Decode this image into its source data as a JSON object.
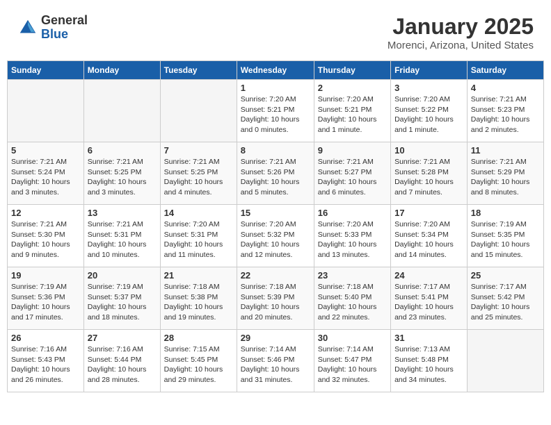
{
  "logo": {
    "general": "General",
    "blue": "Blue"
  },
  "header": {
    "month_title": "January 2025",
    "location": "Morenci, Arizona, United States"
  },
  "weekdays": [
    "Sunday",
    "Monday",
    "Tuesday",
    "Wednesday",
    "Thursday",
    "Friday",
    "Saturday"
  ],
  "weeks": [
    [
      {
        "day": "",
        "sunrise": "",
        "sunset": "",
        "daylight": ""
      },
      {
        "day": "",
        "sunrise": "",
        "sunset": "",
        "daylight": ""
      },
      {
        "day": "",
        "sunrise": "",
        "sunset": "",
        "daylight": ""
      },
      {
        "day": "1",
        "sunrise": "Sunrise: 7:20 AM",
        "sunset": "Sunset: 5:21 PM",
        "daylight": "Daylight: 10 hours and 0 minutes."
      },
      {
        "day": "2",
        "sunrise": "Sunrise: 7:20 AM",
        "sunset": "Sunset: 5:21 PM",
        "daylight": "Daylight: 10 hours and 1 minute."
      },
      {
        "day": "3",
        "sunrise": "Sunrise: 7:20 AM",
        "sunset": "Sunset: 5:22 PM",
        "daylight": "Daylight: 10 hours and 1 minute."
      },
      {
        "day": "4",
        "sunrise": "Sunrise: 7:21 AM",
        "sunset": "Sunset: 5:23 PM",
        "daylight": "Daylight: 10 hours and 2 minutes."
      }
    ],
    [
      {
        "day": "5",
        "sunrise": "Sunrise: 7:21 AM",
        "sunset": "Sunset: 5:24 PM",
        "daylight": "Daylight: 10 hours and 3 minutes."
      },
      {
        "day": "6",
        "sunrise": "Sunrise: 7:21 AM",
        "sunset": "Sunset: 5:25 PM",
        "daylight": "Daylight: 10 hours and 3 minutes."
      },
      {
        "day": "7",
        "sunrise": "Sunrise: 7:21 AM",
        "sunset": "Sunset: 5:25 PM",
        "daylight": "Daylight: 10 hours and 4 minutes."
      },
      {
        "day": "8",
        "sunrise": "Sunrise: 7:21 AM",
        "sunset": "Sunset: 5:26 PM",
        "daylight": "Daylight: 10 hours and 5 minutes."
      },
      {
        "day": "9",
        "sunrise": "Sunrise: 7:21 AM",
        "sunset": "Sunset: 5:27 PM",
        "daylight": "Daylight: 10 hours and 6 minutes."
      },
      {
        "day": "10",
        "sunrise": "Sunrise: 7:21 AM",
        "sunset": "Sunset: 5:28 PM",
        "daylight": "Daylight: 10 hours and 7 minutes."
      },
      {
        "day": "11",
        "sunrise": "Sunrise: 7:21 AM",
        "sunset": "Sunset: 5:29 PM",
        "daylight": "Daylight: 10 hours and 8 minutes."
      }
    ],
    [
      {
        "day": "12",
        "sunrise": "Sunrise: 7:21 AM",
        "sunset": "Sunset: 5:30 PM",
        "daylight": "Daylight: 10 hours and 9 minutes."
      },
      {
        "day": "13",
        "sunrise": "Sunrise: 7:21 AM",
        "sunset": "Sunset: 5:31 PM",
        "daylight": "Daylight: 10 hours and 10 minutes."
      },
      {
        "day": "14",
        "sunrise": "Sunrise: 7:20 AM",
        "sunset": "Sunset: 5:31 PM",
        "daylight": "Daylight: 10 hours and 11 minutes."
      },
      {
        "day": "15",
        "sunrise": "Sunrise: 7:20 AM",
        "sunset": "Sunset: 5:32 PM",
        "daylight": "Daylight: 10 hours and 12 minutes."
      },
      {
        "day": "16",
        "sunrise": "Sunrise: 7:20 AM",
        "sunset": "Sunset: 5:33 PM",
        "daylight": "Daylight: 10 hours and 13 minutes."
      },
      {
        "day": "17",
        "sunrise": "Sunrise: 7:20 AM",
        "sunset": "Sunset: 5:34 PM",
        "daylight": "Daylight: 10 hours and 14 minutes."
      },
      {
        "day": "18",
        "sunrise": "Sunrise: 7:19 AM",
        "sunset": "Sunset: 5:35 PM",
        "daylight": "Daylight: 10 hours and 15 minutes."
      }
    ],
    [
      {
        "day": "19",
        "sunrise": "Sunrise: 7:19 AM",
        "sunset": "Sunset: 5:36 PM",
        "daylight": "Daylight: 10 hours and 17 minutes."
      },
      {
        "day": "20",
        "sunrise": "Sunrise: 7:19 AM",
        "sunset": "Sunset: 5:37 PM",
        "daylight": "Daylight: 10 hours and 18 minutes."
      },
      {
        "day": "21",
        "sunrise": "Sunrise: 7:18 AM",
        "sunset": "Sunset: 5:38 PM",
        "daylight": "Daylight: 10 hours and 19 minutes."
      },
      {
        "day": "22",
        "sunrise": "Sunrise: 7:18 AM",
        "sunset": "Sunset: 5:39 PM",
        "daylight": "Daylight: 10 hours and 20 minutes."
      },
      {
        "day": "23",
        "sunrise": "Sunrise: 7:18 AM",
        "sunset": "Sunset: 5:40 PM",
        "daylight": "Daylight: 10 hours and 22 minutes."
      },
      {
        "day": "24",
        "sunrise": "Sunrise: 7:17 AM",
        "sunset": "Sunset: 5:41 PM",
        "daylight": "Daylight: 10 hours and 23 minutes."
      },
      {
        "day": "25",
        "sunrise": "Sunrise: 7:17 AM",
        "sunset": "Sunset: 5:42 PM",
        "daylight": "Daylight: 10 hours and 25 minutes."
      }
    ],
    [
      {
        "day": "26",
        "sunrise": "Sunrise: 7:16 AM",
        "sunset": "Sunset: 5:43 PM",
        "daylight": "Daylight: 10 hours and 26 minutes."
      },
      {
        "day": "27",
        "sunrise": "Sunrise: 7:16 AM",
        "sunset": "Sunset: 5:44 PM",
        "daylight": "Daylight: 10 hours and 28 minutes."
      },
      {
        "day": "28",
        "sunrise": "Sunrise: 7:15 AM",
        "sunset": "Sunset: 5:45 PM",
        "daylight": "Daylight: 10 hours and 29 minutes."
      },
      {
        "day": "29",
        "sunrise": "Sunrise: 7:14 AM",
        "sunset": "Sunset: 5:46 PM",
        "daylight": "Daylight: 10 hours and 31 minutes."
      },
      {
        "day": "30",
        "sunrise": "Sunrise: 7:14 AM",
        "sunset": "Sunset: 5:47 PM",
        "daylight": "Daylight: 10 hours and 32 minutes."
      },
      {
        "day": "31",
        "sunrise": "Sunrise: 7:13 AM",
        "sunset": "Sunset: 5:48 PM",
        "daylight": "Daylight: 10 hours and 34 minutes."
      },
      {
        "day": "",
        "sunrise": "",
        "sunset": "",
        "daylight": ""
      }
    ]
  ]
}
